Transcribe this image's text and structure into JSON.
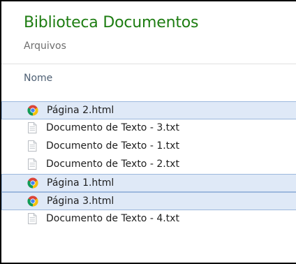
{
  "library": {
    "title": "Biblioteca Documentos",
    "subtitle": "Arquivos"
  },
  "columns": {
    "name_header": "Nome"
  },
  "files": [
    {
      "name": "Página 2.html",
      "icon": "chrome-icon",
      "selected": true
    },
    {
      "name": "Documento de Texto - 3.txt",
      "icon": "text-document-icon",
      "selected": false
    },
    {
      "name": "Documento de Texto - 1.txt",
      "icon": "text-document-icon",
      "selected": false
    },
    {
      "name": "Documento de Texto - 2.txt",
      "icon": "text-document-icon",
      "selected": false
    },
    {
      "name": "Página 1.html",
      "icon": "chrome-icon",
      "selected": true
    },
    {
      "name": "Página 3.html",
      "icon": "chrome-icon",
      "selected": true
    },
    {
      "name": "Documento de Texto - 4.txt",
      "icon": "text-document-icon",
      "selected": false
    }
  ],
  "colors": {
    "title": "#1e7d12",
    "selection_fill": "#dfe9f7",
    "selection_border": "#9cb8dd"
  }
}
